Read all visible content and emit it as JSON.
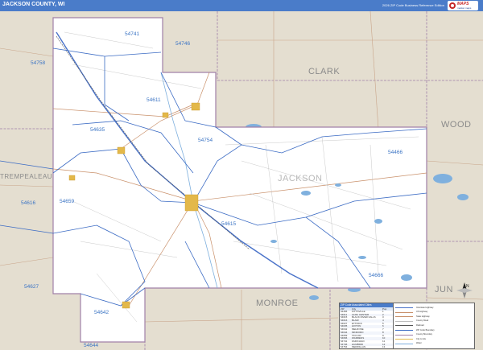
{
  "header": {
    "title": "JACKSON COUNTY, WI",
    "edition": "2026 ZIP Code Business Reference Edition",
    "logo_text": "MAPS",
    "logo_sub": "market maps"
  },
  "map": {
    "counties": {
      "clark": "CLARK",
      "wood": "WOOD",
      "jackson": "JACKSON",
      "trempealeau": "TREMPEALEAU",
      "monroe": "MONROE",
      "juneau_partial": "JUN"
    },
    "zip_codes": {
      "z54741": "54741",
      "z54746": "54746",
      "z54758": "54758",
      "z54611": "54611",
      "z54635": "54635",
      "z54754": "54754",
      "z54466": "54466",
      "z54616": "54616",
      "z54659": "54659",
      "z54615": "54615",
      "z54627": "54627",
      "z54666": "54666",
      "z54642": "54642",
      "z54644": "54644"
    },
    "colors": {
      "county_fill": "#ffffff",
      "surrounding_fill": "#e4ded0",
      "water": "#7fb0de",
      "zip_boundary": "#3b6bc4",
      "county_boundary": "#a080a8",
      "interstate": "#4a73c9",
      "highway": "#c9906a",
      "railroad": "#555555",
      "city": "#e3b84a"
    }
  },
  "zip_table": {
    "title": "ZIP Code Associated Cities",
    "headers": [
      "ZIP",
      "City",
      "Pop"
    ],
    "rows": [
      [
        "54466",
        "PITTSVILLE",
        "1"
      ],
      [
        "54611",
        "ALMA CENTER",
        "2"
      ],
      [
        "54615",
        "BLACK RIVER FALLS",
        "3"
      ],
      [
        "54616",
        "BLAIR",
        "4"
      ],
      [
        "54627",
        "ETTRICK",
        "5"
      ],
      [
        "54635",
        "HIXTON",
        "6"
      ],
      [
        "54642",
        "MELROSE",
        "7"
      ],
      [
        "54644",
        "MINDORO",
        "8"
      ],
      [
        "54659",
        "TAYLOR",
        "9"
      ],
      [
        "54666",
        "WARRENS",
        "10"
      ],
      [
        "54741",
        "FAIRCHILD",
        "11"
      ],
      [
        "54746",
        "HUMBIRD",
        "12"
      ],
      [
        "54754",
        "MERRILLAN",
        "13"
      ],
      [
        "54758",
        "OSSEO",
        "14"
      ]
    ]
  },
  "legend": {
    "items": [
      "Interstate Highway",
      "US Highway",
      "State Highway",
      "County Road",
      "Railroad",
      "ZIP Code Boundary",
      "County Boundary",
      "City Limits",
      "Water"
    ],
    "north": "N"
  }
}
